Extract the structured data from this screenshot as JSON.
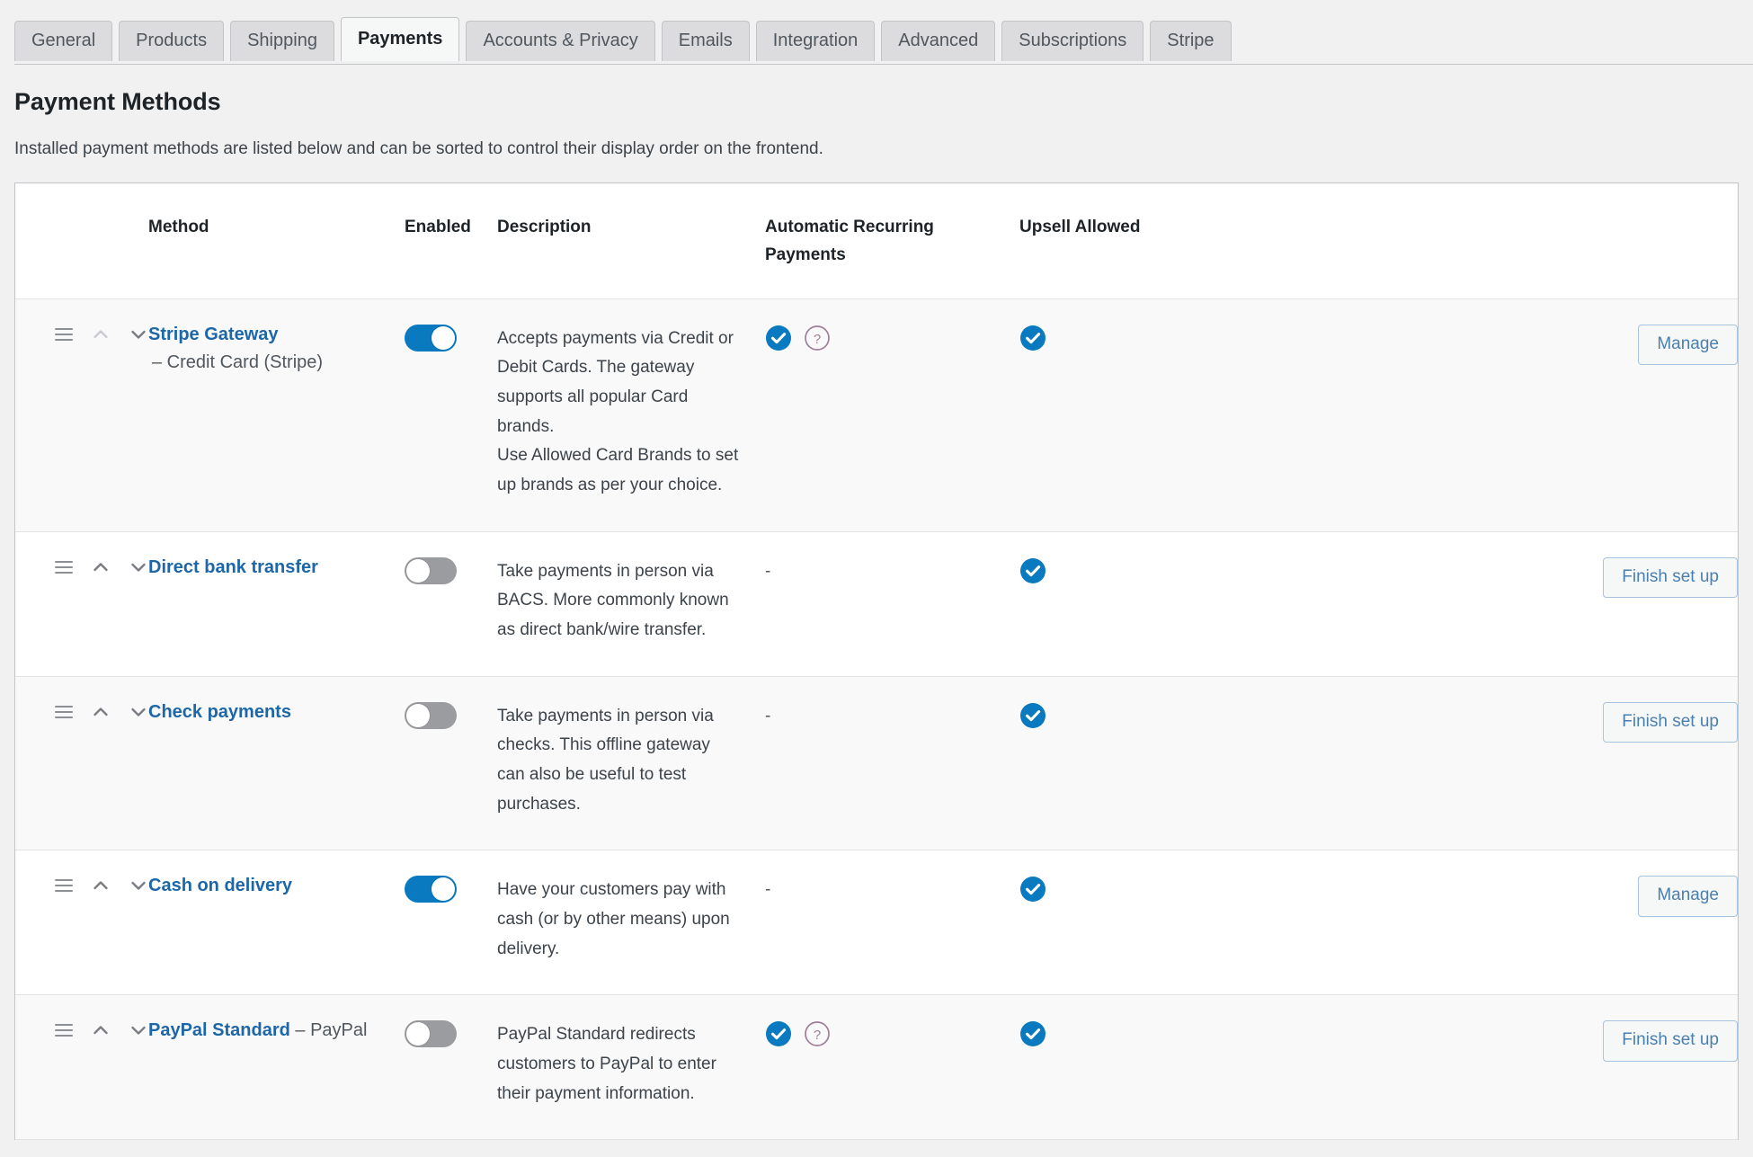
{
  "tabs": [
    {
      "label": "General",
      "active": false
    },
    {
      "label": "Products",
      "active": false
    },
    {
      "label": "Shipping",
      "active": false
    },
    {
      "label": "Payments",
      "active": true
    },
    {
      "label": "Accounts & Privacy",
      "active": false
    },
    {
      "label": "Emails",
      "active": false
    },
    {
      "label": "Integration",
      "active": false
    },
    {
      "label": "Advanced",
      "active": false
    },
    {
      "label": "Subscriptions",
      "active": false
    },
    {
      "label": "Stripe",
      "active": false
    }
  ],
  "page": {
    "title": "Payment Methods",
    "description": "Installed payment methods are listed below and can be sorted to control their display order on the frontend."
  },
  "table": {
    "headers": {
      "sort": "",
      "method": "Method",
      "enabled": "Enabled",
      "description": "Description",
      "recurring": "Automatic Recurring Payments",
      "recurring_line1": "Automatic Recurring",
      "recurring_line2": "Payments",
      "upsell": "Upsell Allowed",
      "action": ""
    },
    "rows": [
      {
        "name": "Stripe Gateway",
        "name_suffix": "",
        "subtitle": "– Credit Card (Stripe)",
        "enabled": true,
        "enabled_state": "on",
        "description_lines": [
          "Accepts payments via Credit or Debit Cards. The gateway supports all popular Card brands.",
          "Use Allowed Card Brands to set up brands as per your choice."
        ],
        "recurring": "check-with-help",
        "recurring_dash": "",
        "upsell": "check",
        "action_label": "Manage",
        "shade": true,
        "up_disabled": true
      },
      {
        "name": "Direct bank transfer",
        "name_suffix": "",
        "subtitle": "",
        "enabled": false,
        "enabled_state": "off",
        "description_lines": [
          "Take payments in person via BACS. More commonly known as direct bank/wire transfer."
        ],
        "recurring": "dash",
        "recurring_dash": "-",
        "upsell": "check",
        "action_label": "Finish set up",
        "shade": false,
        "up_disabled": false
      },
      {
        "name": "Check payments",
        "name_suffix": "",
        "subtitle": "",
        "enabled": false,
        "enabled_state": "off",
        "description_lines": [
          "Take payments in person via checks. This offline gateway can also be useful to test purchases."
        ],
        "recurring": "dash",
        "recurring_dash": "-",
        "upsell": "check",
        "action_label": "Finish set up",
        "shade": true,
        "up_disabled": false
      },
      {
        "name": "Cash on delivery",
        "name_suffix": "",
        "subtitle": "",
        "enabled": true,
        "enabled_state": "on",
        "description_lines": [
          "Have your customers pay with cash (or by other means) upon delivery."
        ],
        "recurring": "dash",
        "recurring_dash": "-",
        "upsell": "check",
        "action_label": "Manage",
        "shade": false,
        "up_disabled": false
      },
      {
        "name": "PayPal Standard",
        "name_suffix": " – PayPal",
        "subtitle": "",
        "enabled": false,
        "enabled_state": "off",
        "description_lines": [
          "PayPal Standard redirects customers to PayPal to enter their payment information."
        ],
        "recurring": "check-with-help",
        "recurring_dash": "",
        "upsell": "check",
        "action_label": "Finish set up",
        "shade": true,
        "up_disabled": false
      }
    ]
  },
  "icons": {
    "drag": "drag-handle-icon",
    "up": "chevron-up-icon",
    "down": "chevron-down-icon",
    "check": "check-circle-icon",
    "help": "help-circle-icon"
  },
  "colors": {
    "accent_blue": "#0a7ac0",
    "link_blue": "#1d66a8",
    "help_mauve": "#a07e98",
    "toggle_off": "#9a9c9f",
    "row_shade": "#f9f9f9",
    "border": "#e3e3e4",
    "page_bg": "#f1f1f1"
  }
}
